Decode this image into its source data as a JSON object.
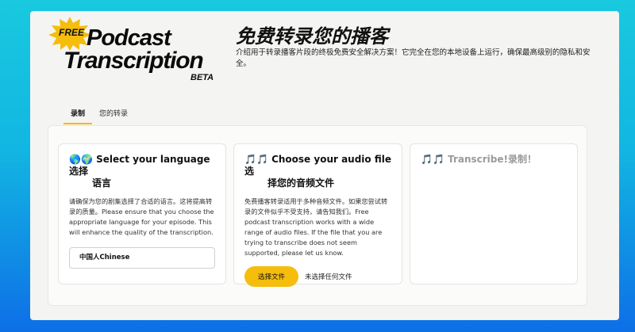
{
  "logo": {
    "badge": "FREE",
    "line1": "Podcast",
    "line2": "Transcription",
    "beta": "BETA"
  },
  "header": {
    "title": "免费转录您的播客",
    "description": "介绍用于转录播客片段的终极免费安全解决方案！它完全在您的本地设备上运行，确保最高级别的隐私和安全。"
  },
  "tabs": [
    {
      "label": "录制",
      "active": true
    },
    {
      "label": "您的转录",
      "active": false
    }
  ],
  "cards": {
    "language": {
      "icon": "🌎🌍",
      "title_line1": "Select your language选择",
      "title_line2": "语言",
      "body": "请确保为您的剧集选择了合适的语言。这将提高转录的质量。Please ensure that you choose the appropriate language for your episode. This will enhance the quality of the transcription.",
      "selected_language": "中国人Chinese"
    },
    "audio": {
      "icon": "🎵🎵",
      "title_line1": "Choose your audio file选",
      "title_line2": "择您的音频文件",
      "body": "免费播客转录适用于多种音频文件。如果您尝试转录的文件似乎不受支持，请告知我们。Free podcast transcription works with a wide range of audio files. If the file that you are trying to transcribe does not seem supported, please let us know.",
      "button_label": "选择文件",
      "file_status": "未选择任何文件"
    },
    "transcribe": {
      "icon": "🎵🎵",
      "title": "Transcribe!录制！"
    }
  },
  "colors": {
    "accent": "#f5bd0c",
    "bg_top": "#19c9df",
    "bg_bottom": "#0e6fe7"
  }
}
